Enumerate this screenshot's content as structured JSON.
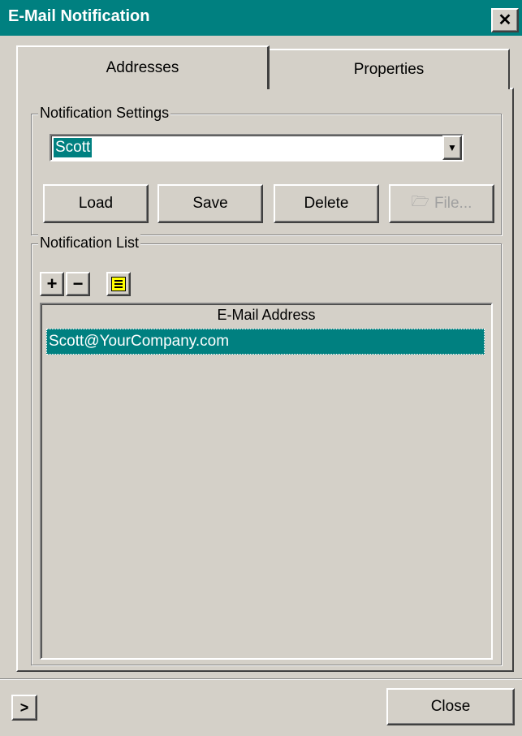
{
  "window": {
    "title": "E-Mail Notification",
    "close_glyph": "✕"
  },
  "tabs": [
    {
      "label": "Addresses",
      "selected": true
    },
    {
      "label": "Properties",
      "selected": false
    }
  ],
  "settings": {
    "legend": "Notification Settings",
    "selected_value": "Scott",
    "buttons": {
      "load": "Load",
      "save": "Save",
      "delete": "Delete",
      "file": "File..."
    }
  },
  "list": {
    "legend": "Notification List",
    "column_header": "E-Mail Address",
    "rows": [
      "Scott@YourCompany.com"
    ],
    "add_glyph": "+",
    "remove_glyph": "−"
  },
  "footer": {
    "expand_glyph": ">",
    "close_label": "Close"
  },
  "colors": {
    "titlebar": "#008080",
    "selection": "#008080",
    "face": "#d4d0c8"
  }
}
